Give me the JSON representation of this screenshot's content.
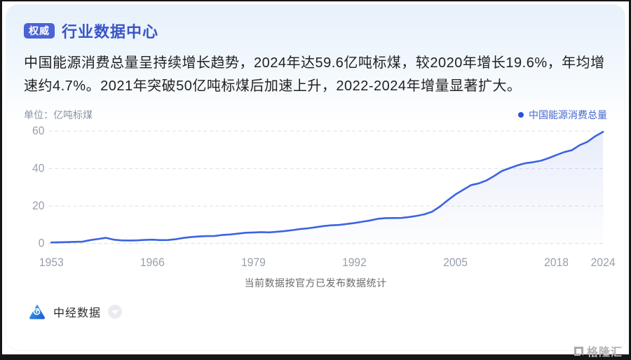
{
  "header": {
    "badge": "权威",
    "title": "行业数据中心"
  },
  "description": "中国能源消费总量呈持续增长趋势，2024年达59.6亿吨标煤，较2020年增长19.6%，年均增速约4.7%。2021年突破50亿吨标煤后加速上升，2022-2024年增量显著扩大。",
  "chart_meta": {
    "unit_label": "单位：亿吨标煤",
    "legend_label": "中国能源消费总量"
  },
  "chart_data": {
    "type": "line",
    "title": "中国能源消费总量",
    "ylabel": "亿吨标煤",
    "x": [
      1953,
      1954,
      1955,
      1956,
      1957,
      1958,
      1959,
      1960,
      1961,
      1962,
      1963,
      1964,
      1965,
      1966,
      1967,
      1968,
      1969,
      1970,
      1971,
      1972,
      1973,
      1974,
      1975,
      1976,
      1977,
      1978,
      1979,
      1980,
      1981,
      1982,
      1983,
      1984,
      1985,
      1986,
      1987,
      1988,
      1989,
      1990,
      1991,
      1992,
      1993,
      1994,
      1995,
      1996,
      1997,
      1998,
      1999,
      2000,
      2001,
      2002,
      2003,
      2004,
      2005,
      2006,
      2007,
      2008,
      2009,
      2010,
      2011,
      2012,
      2013,
      2014,
      2015,
      2016,
      2017,
      2018,
      2019,
      2020,
      2021,
      2022,
      2023,
      2024
    ],
    "values": [
      0.54,
      0.62,
      0.7,
      0.88,
      0.96,
      1.76,
      2.39,
      3.02,
      2.04,
      1.65,
      1.56,
      1.66,
      1.89,
      2.03,
      1.83,
      1.84,
      2.27,
      2.93,
      3.45,
      3.73,
      3.91,
      4.01,
      4.54,
      4.78,
      5.24,
      5.71,
      5.86,
      6.03,
      5.94,
      6.21,
      6.6,
      7.09,
      7.67,
      8.09,
      8.66,
      9.3,
      9.69,
      9.87,
      10.38,
      10.92,
      11.6,
      12.27,
      13.12,
      13.52,
      13.59,
      13.62,
      14.06,
      14.7,
      15.55,
      16.96,
      19.71,
      23.03,
      26.14,
      28.63,
      31.14,
      32.06,
      33.61,
      36.06,
      38.7,
      40.21,
      41.69,
      42.83,
      43.41,
      44.15,
      45.56,
      47.19,
      48.75,
      49.83,
      52.49,
      54.27,
      57.25,
      59.6
    ],
    "ylim": [
      0,
      60
    ],
    "yticks": [
      0,
      20,
      40,
      60
    ],
    "xticks": [
      1953,
      1966,
      1979,
      1992,
      2005,
      2018,
      2024
    ],
    "grid": "horizontal-dashed",
    "legend_position": "top-right",
    "line_color": "#3c64e0",
    "legend_dot_color": "#2b50e0",
    "area_fill_top": "rgba(82,113,219,0.13)",
    "area_fill_bottom": "rgba(82,113,219,0.01)",
    "grid_color": "#e2e5ea",
    "axis_label_color": "#98a0ad"
  },
  "caption": "当前数据按官方已发布数据统计",
  "footer": {
    "source_name": "中经数据"
  },
  "watermark": {
    "text": "格隆汇"
  }
}
